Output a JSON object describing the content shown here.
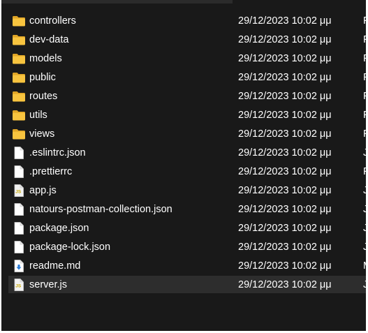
{
  "explorer": {
    "files": [
      {
        "name": "controllers",
        "date": "29/12/2023 10:02 μμ",
        "type": "F",
        "icon": "folder-icon"
      },
      {
        "name": "dev-data",
        "date": "29/12/2023 10:02 μμ",
        "type": "F",
        "icon": "folder-icon"
      },
      {
        "name": "models",
        "date": "29/12/2023 10:02 μμ",
        "type": "F",
        "icon": "folder-icon"
      },
      {
        "name": "public",
        "date": "29/12/2023 10:02 μμ",
        "type": "F",
        "icon": "folder-icon"
      },
      {
        "name": "routes",
        "date": "29/12/2023 10:02 μμ",
        "type": "F",
        "icon": "folder-icon"
      },
      {
        "name": "utils",
        "date": "29/12/2023 10:02 μμ",
        "type": "F",
        "icon": "folder-icon"
      },
      {
        "name": "views",
        "date": "29/12/2023 10:02 μμ",
        "type": "F",
        "icon": "folder-icon"
      },
      {
        "name": ".eslintrc.json",
        "date": "29/12/2023 10:02 μμ",
        "type": "J",
        "icon": "file-icon"
      },
      {
        "name": ".prettierrc",
        "date": "29/12/2023 10:02 μμ",
        "type": "F",
        "icon": "file-icon"
      },
      {
        "name": "app.js",
        "date": "29/12/2023 10:02 μμ",
        "type": "J",
        "icon": "js-file-icon"
      },
      {
        "name": "natours-postman-collection.json",
        "date": "29/12/2023 10:02 μμ",
        "type": "J",
        "icon": "file-icon"
      },
      {
        "name": "package.json",
        "date": "29/12/2023 10:02 μμ",
        "type": "J",
        "icon": "file-icon"
      },
      {
        "name": "package-lock.json",
        "date": "29/12/2023 10:02 μμ",
        "type": "J",
        "icon": "file-icon"
      },
      {
        "name": "readme.md",
        "date": "29/12/2023 10:02 μμ",
        "type": "M",
        "icon": "markdown-file-icon"
      },
      {
        "name": "server.js",
        "date": "29/12/2023 10:02 μμ",
        "type": "J",
        "icon": "js-file-icon",
        "selected": true
      }
    ]
  },
  "colors": {
    "background": "#191919",
    "text": "#ffffff",
    "selection": "#2d2d2d",
    "folder": "#f8c43f",
    "js_badge": "#d4b400"
  }
}
